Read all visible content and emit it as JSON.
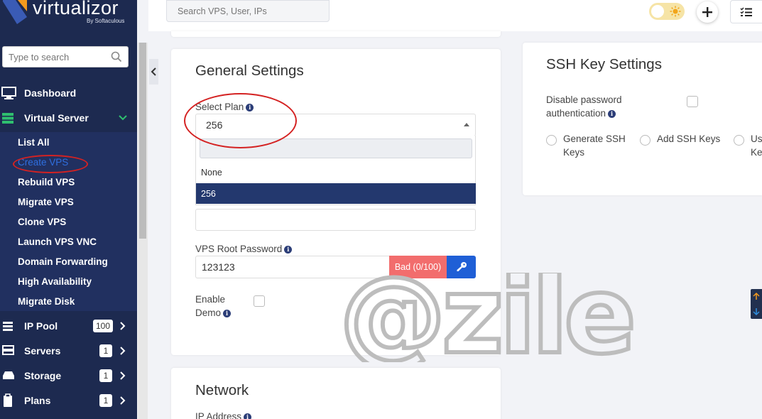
{
  "brand": {
    "name": "virtualizor",
    "by": "By Softaculous"
  },
  "sidebar": {
    "search_placeholder": "Type to search",
    "items": [
      {
        "label": "Dashboard",
        "icon": "monitor-icon"
      },
      {
        "label": "Virtual Server",
        "icon": "server-stack-icon",
        "expanded": true
      },
      {
        "label": "IP Pool",
        "icon": "ip-pool-icon",
        "badge": "100"
      },
      {
        "label": "Servers",
        "icon": "servers-icon",
        "badge": "1"
      },
      {
        "label": "Storage",
        "icon": "storage-icon",
        "badge": "1"
      },
      {
        "label": "Plans",
        "icon": "clipboard-icon",
        "badge": "1"
      }
    ],
    "sub_items": [
      "List All",
      "Create VPS",
      "Rebuild VPS",
      "Migrate VPS",
      "Clone VPS",
      "Launch VPS VNC",
      "Domain Forwarding",
      "High Availability",
      "Migrate Disk"
    ],
    "active_sub_item": "Create VPS"
  },
  "topbar": {
    "search_placeholder": "Search VPS, User, IPs"
  },
  "general": {
    "title": "General Settings",
    "select_plan_label": "Select Plan",
    "select_plan_value": "256",
    "dropdown_options": [
      "None",
      "256"
    ],
    "dropdown_selected": "256",
    "root_password_label": "VPS Root Password",
    "root_password_value": "123123",
    "password_strength": "Bad (0/100)",
    "enable_demo_label_1": "Enable",
    "enable_demo_label_2": "Demo"
  },
  "ssh": {
    "title": "SSH Key Settings",
    "disable_pw_label_1": "Disable password",
    "disable_pw_label_2": "authentication",
    "radio_generate_1": "Generate SSH",
    "radio_generate_2": "Keys",
    "radio_add": "Add SSH Keys",
    "radio_use_1": "Us",
    "radio_use_2": "Ke"
  },
  "network": {
    "title": "Network",
    "ip_label": "IP Address"
  },
  "watermark": {
    "text": "@zile"
  },
  "colors": {
    "sidebar_bg": "#1d2a50",
    "submenu_bg": "#213060",
    "selected_option": "#23386e",
    "key_button": "#1f5fd6",
    "bad_strength": "#f26d6d",
    "annotation_red": "#d42222",
    "active_link": "#2f6fe0"
  }
}
